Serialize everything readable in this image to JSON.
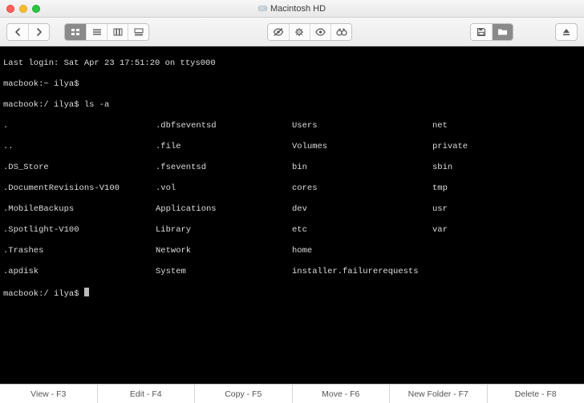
{
  "window": {
    "title": "Macintosh HD"
  },
  "terminal": {
    "last_login": "Last login: Sat Apr 23 17:51:20 on ttys000",
    "prompt1": "macbook:~ ilya$",
    "prompt2": "macbook:/ ilya$ ",
    "command": "ls -a",
    "prompt3": "macbook:/ ilya$ ",
    "ls_columns": {
      "col0": [
        ".",
        "..",
        ".DS_Store",
        ".DocumentRevisions-V100",
        ".MobileBackups",
        ".Spotlight-V100",
        ".Trashes",
        ".apdisk"
      ],
      "col1": [
        ".dbfseventsd",
        ".file",
        ".fseventsd",
        ".vol",
        "Applications",
        "Library",
        "Network",
        "System"
      ],
      "col2": [
        "Users",
        "Volumes",
        "bin",
        "cores",
        "dev",
        "etc",
        "home",
        "installer.failurerequests"
      ],
      "col3": [
        "net",
        "private",
        "sbin",
        "tmp",
        "usr",
        "var",
        "",
        ""
      ]
    }
  },
  "bottombar": {
    "view": "View - F3",
    "edit": "Edit - F4",
    "copy": "Copy - F5",
    "move": "Move - F6",
    "newf": "New Folder - F7",
    "delete": "Delete - F8"
  }
}
